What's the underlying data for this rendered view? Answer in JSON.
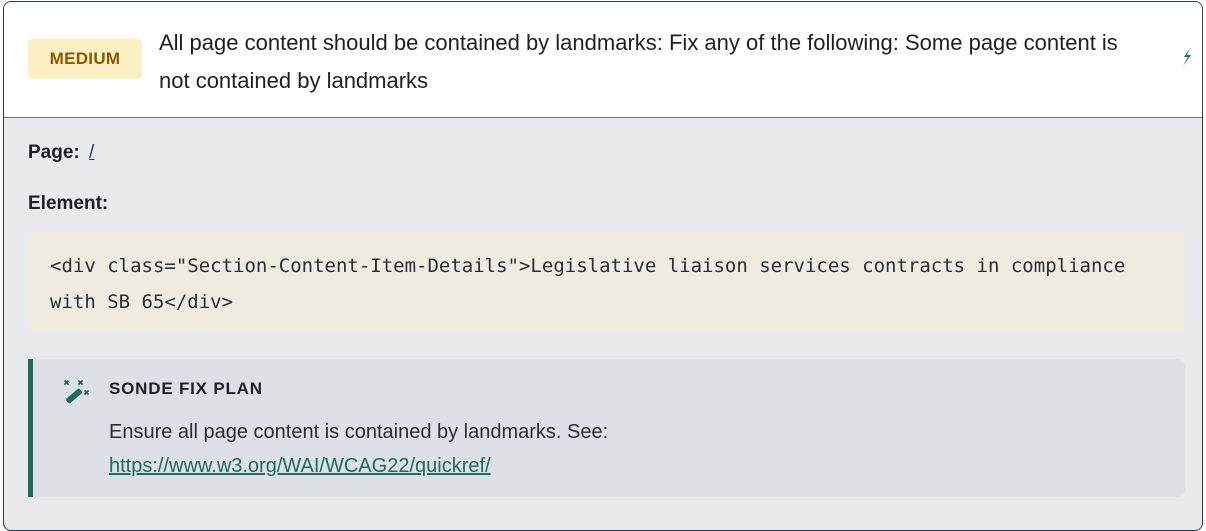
{
  "issue": {
    "severity_label": "MEDIUM",
    "title": "All page content should be contained by landmarks: Fix any of the following: Some page content is not contained by landmarks",
    "expand_icon": "lightning-icon"
  },
  "details": {
    "page_label": "Page:",
    "page_value": "/",
    "element_label": "Element:",
    "element_code": "<div class=\"Section-Content-Item-Details\">Legislative liaison services contracts in compliance with SB 65</div>"
  },
  "fix_plan": {
    "icon": "magic-wand-icon",
    "heading": "SONDE FIX PLAN",
    "text": "Ensure all page content is contained by landmarks. See:",
    "link": "https://www.w3.org/WAI/WCAG22/quickref/"
  },
  "colors": {
    "accent": "#1f6b5c",
    "badge_bg": "#fbefc4",
    "badge_text": "#8a5a00"
  }
}
